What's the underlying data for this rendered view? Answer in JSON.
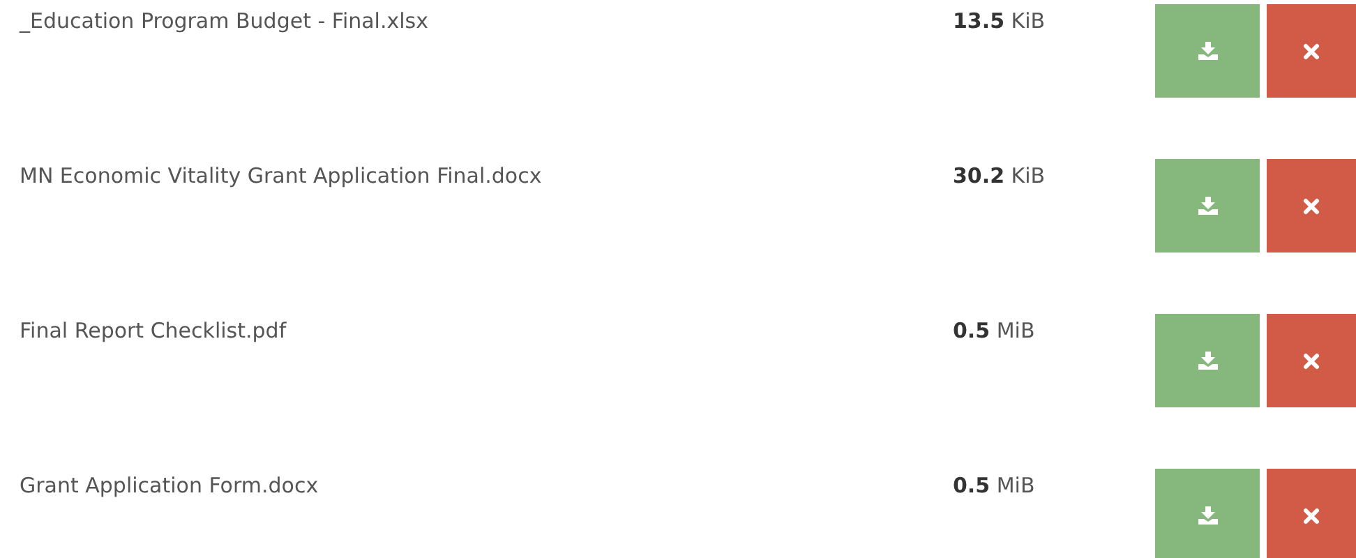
{
  "files": [
    {
      "name": "_Education Program Budget - Final.xlsx",
      "size": "**13.5** KiB"
    },
    {
      "name": "MN Economic Vitality Grant Application Final.docx",
      "size": "**30.2** KiB"
    },
    {
      "name": "Final Report Checklist.pdf",
      "size": "**0.5** MiB"
    },
    {
      "name": "Grant Application Form.docx",
      "size": "**0.5** MiB"
    }
  ]
}
